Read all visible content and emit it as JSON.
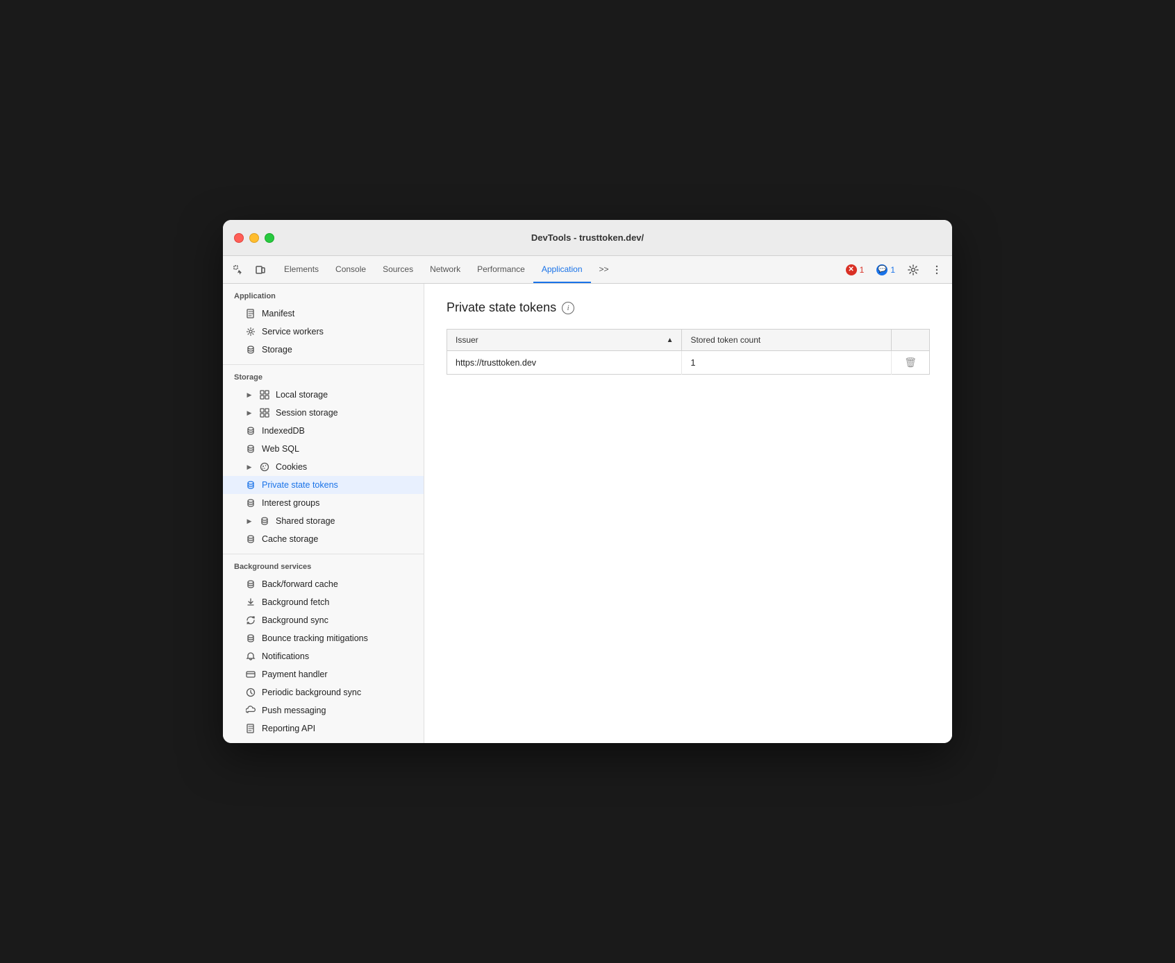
{
  "window": {
    "title": "DevTools - trusttoken.dev/"
  },
  "tabs": [
    {
      "id": "elements",
      "label": "Elements",
      "active": false
    },
    {
      "id": "console",
      "label": "Console",
      "active": false
    },
    {
      "id": "sources",
      "label": "Sources",
      "active": false
    },
    {
      "id": "network",
      "label": "Network",
      "active": false
    },
    {
      "id": "performance",
      "label": "Performance",
      "active": false
    },
    {
      "id": "application",
      "label": "Application",
      "active": true
    }
  ],
  "toolbar": {
    "more_label": ">>",
    "error_count": "1",
    "msg_count": "1"
  },
  "sidebar": {
    "sections": [
      {
        "id": "application",
        "title": "Application",
        "items": [
          {
            "id": "manifest",
            "label": "Manifest",
            "icon": "file",
            "indent": 1,
            "active": false
          },
          {
            "id": "service-workers",
            "label": "Service workers",
            "icon": "gear",
            "indent": 1,
            "active": false
          },
          {
            "id": "storage",
            "label": "Storage",
            "icon": "db",
            "indent": 1,
            "active": false
          }
        ]
      },
      {
        "id": "storage",
        "title": "Storage",
        "items": [
          {
            "id": "local-storage",
            "label": "Local storage",
            "icon": "grid",
            "indent": 1,
            "expandable": true,
            "active": false
          },
          {
            "id": "session-storage",
            "label": "Session storage",
            "icon": "grid",
            "indent": 1,
            "expandable": true,
            "active": false
          },
          {
            "id": "indexeddb",
            "label": "IndexedDB",
            "icon": "db",
            "indent": 1,
            "active": false
          },
          {
            "id": "web-sql",
            "label": "Web SQL",
            "icon": "db",
            "indent": 1,
            "active": false
          },
          {
            "id": "cookies",
            "label": "Cookies",
            "icon": "cookie",
            "indent": 1,
            "expandable": true,
            "active": false
          },
          {
            "id": "private-state-tokens",
            "label": "Private state tokens",
            "icon": "db",
            "indent": 1,
            "active": true
          },
          {
            "id": "interest-groups",
            "label": "Interest groups",
            "icon": "db",
            "indent": 1,
            "active": false
          },
          {
            "id": "shared-storage",
            "label": "Shared storage",
            "icon": "db",
            "indent": 1,
            "expandable": true,
            "active": false
          },
          {
            "id": "cache-storage",
            "label": "Cache storage",
            "icon": "db",
            "indent": 1,
            "active": false
          }
        ]
      },
      {
        "id": "background-services",
        "title": "Background services",
        "items": [
          {
            "id": "back-forward-cache",
            "label": "Back/forward cache",
            "icon": "db",
            "indent": 1,
            "active": false
          },
          {
            "id": "background-fetch",
            "label": "Background fetch",
            "icon": "fetch",
            "indent": 1,
            "active": false
          },
          {
            "id": "background-sync",
            "label": "Background sync",
            "icon": "sync",
            "indent": 1,
            "active": false
          },
          {
            "id": "bounce-tracking",
            "label": "Bounce tracking mitigations",
            "icon": "db",
            "indent": 1,
            "active": false
          },
          {
            "id": "notifications",
            "label": "Notifications",
            "icon": "bell",
            "indent": 1,
            "active": false
          },
          {
            "id": "payment-handler",
            "label": "Payment handler",
            "icon": "payment",
            "indent": 1,
            "active": false
          },
          {
            "id": "periodic-background-sync",
            "label": "Periodic background sync",
            "icon": "clock",
            "indent": 1,
            "active": false
          },
          {
            "id": "push-messaging",
            "label": "Push messaging",
            "icon": "cloud",
            "indent": 1,
            "active": false
          },
          {
            "id": "reporting-api",
            "label": "Reporting API",
            "icon": "file",
            "indent": 1,
            "active": false
          }
        ]
      }
    ]
  },
  "content": {
    "page_title": "Private state tokens",
    "table": {
      "columns": [
        {
          "id": "issuer",
          "label": "Issuer",
          "sortable": true
        },
        {
          "id": "stored-token-count",
          "label": "Stored token count",
          "sortable": false
        },
        {
          "id": "actions",
          "label": "",
          "sortable": false
        }
      ],
      "rows": [
        {
          "issuer": "https://trusttoken.dev",
          "stored_token_count": "1"
        }
      ]
    }
  }
}
